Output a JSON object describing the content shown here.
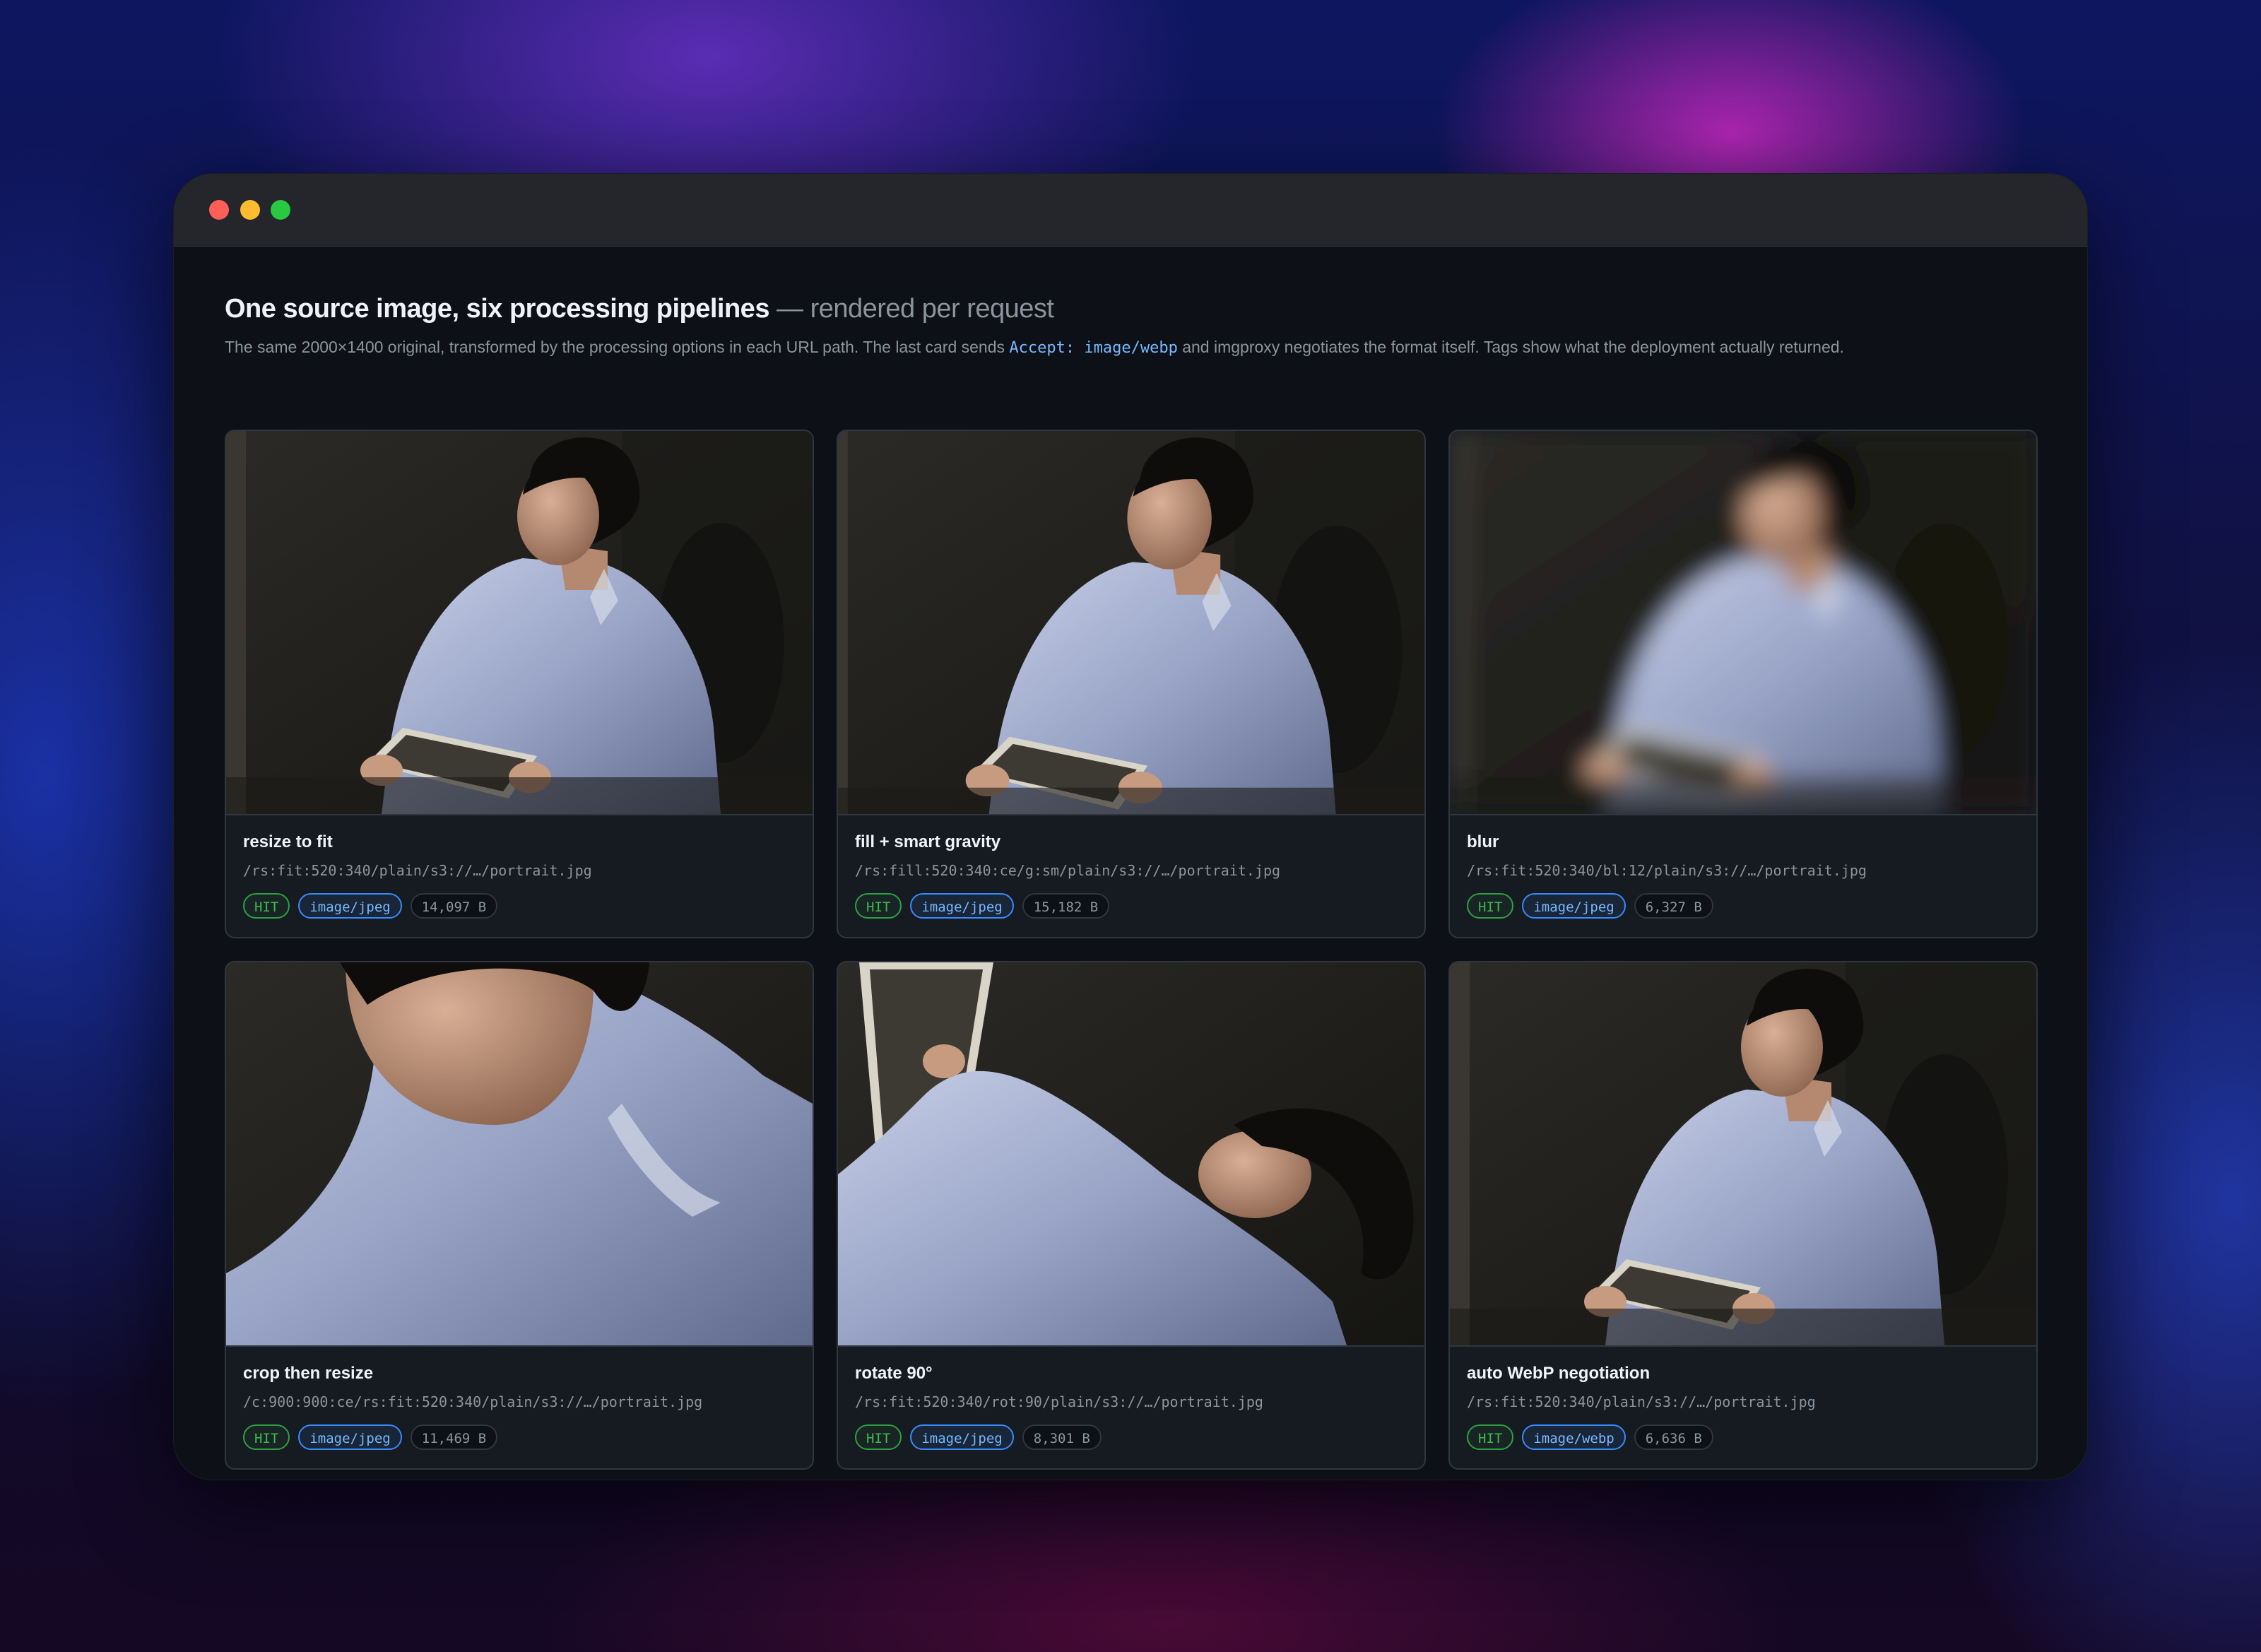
{
  "window": {
    "controls": [
      "close",
      "minimize",
      "zoom"
    ]
  },
  "header": {
    "title": "One source image, six processing pipelines",
    "subtitle": " — rendered per request",
    "desc_before": "The same 2000×1400 original, transformed by the processing options in each URL path. The last card sends ",
    "desc_code": "Accept: image/webp",
    "desc_after": " and imgproxy negotiates the format itself. Tags show what the deployment actually returned."
  },
  "cards": [
    {
      "title": "resize to fit",
      "path": "/rs:fit:520:340/plain/s3://…/portrait.jpg",
      "cache": "HIT",
      "mime": "image/jpeg",
      "size": "14,097 B"
    },
    {
      "title": "fill + smart gravity",
      "path": "/rs:fill:520:340:ce/g:sm/plain/s3://…/portrait.jpg",
      "cache": "HIT",
      "mime": "image/jpeg",
      "size": "15,182 B"
    },
    {
      "title": "blur",
      "path": "/rs:fit:520:340/bl:12/plain/s3://…/portrait.jpg",
      "cache": "HIT",
      "mime": "image/jpeg",
      "size": "6,327 B"
    },
    {
      "title": "crop then resize",
      "path": "/c:900:900:ce/rs:fit:520:340/plain/s3://…/portrait.jpg",
      "cache": "HIT",
      "mime": "image/jpeg",
      "size": "11,469 B"
    },
    {
      "title": "rotate 90°",
      "path": "/rs:fit:520:340/rot:90/plain/s3://…/portrait.jpg",
      "cache": "HIT",
      "mime": "image/jpeg",
      "size": "8,301 B"
    },
    {
      "title": "auto WebP negotiation",
      "path": "/rs:fit:520:340/plain/s3://…/portrait.jpg",
      "cache": "HIT",
      "mime": "image/webp",
      "size": "6,636 B"
    }
  ],
  "colors": {
    "hit": "#3fb950",
    "mime": "#79b8ff",
    "accent": "#388bfd"
  }
}
